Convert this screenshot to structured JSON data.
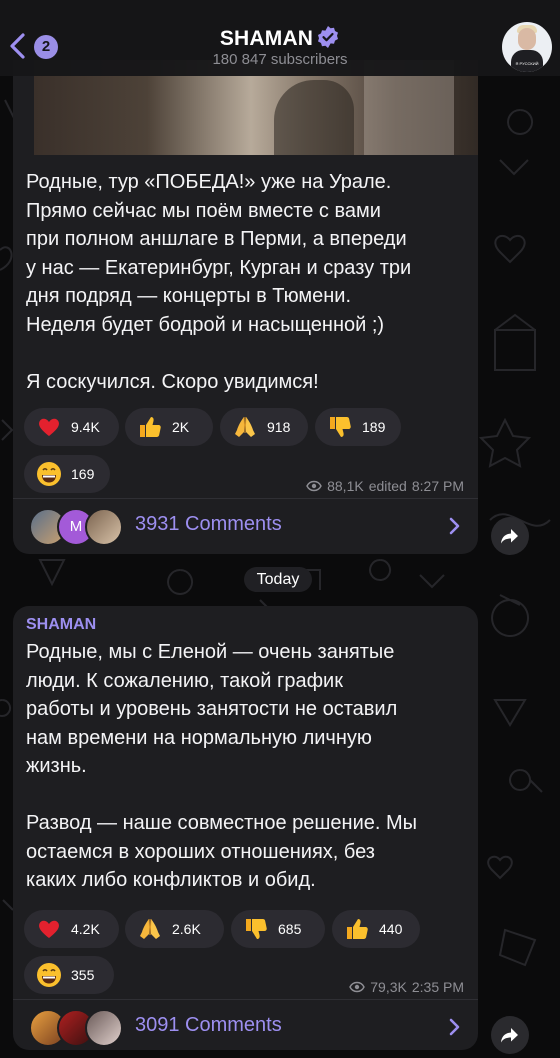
{
  "header": {
    "back_badge": "2",
    "title": "SHAMAN",
    "subtitle": "180 847 subscribers",
    "avatar_caption": "Я РУССКИЙ"
  },
  "posts": [
    {
      "sender": "",
      "text": "Родные, тур «ПОБЕДА!» уже на Урале.\nПрямо сейчас мы поём вместе с вами\nпри полном аншлаге в Перми, а впереди\nу нас — Екатеринбург, Курган и сразу три\nдня подряд — концерты в Тюмени.\nНеделя будет бодрой и насыщенной ;)\n\nЯ соскучился. Скоро увидимся!",
      "reactions": [
        {
          "icon": "heart-icon",
          "count": "9.4K"
        },
        {
          "icon": "thumbs-up-icon",
          "count": "2K"
        },
        {
          "icon": "folded-hands-icon",
          "count": "918"
        },
        {
          "icon": "thumbs-down-icon",
          "count": "189"
        },
        {
          "icon": "grinning-face-icon",
          "count": "169"
        }
      ],
      "views": "88,1K",
      "edited": "edited",
      "time": "8:27 PM",
      "comments": "3931 Comments",
      "commenter_initial": "M"
    },
    {
      "sender": "SHAMAN",
      "text": "Родные, мы с Еленой — очень занятые\nлюди. К сожалению, такой график\nработы и уровень занятости не оставил\nнам времени на нормальную личную\nжизнь.\n\nРазвод — наше совместное решение. Мы\nостаемся в хороших отношениях, без\nкаких либо конфликтов и обид.",
      "reactions": [
        {
          "icon": "heart-icon",
          "count": "4.2K"
        },
        {
          "icon": "folded-hands-icon",
          "count": "2.6K"
        },
        {
          "icon": "thumbs-down-icon",
          "count": "685"
        },
        {
          "icon": "thumbs-up-icon",
          "count": "440"
        },
        {
          "icon": "grinning-face-icon",
          "count": "355"
        }
      ],
      "views": "79,3K",
      "time": "2:35 PM",
      "comments": "3091 Comments"
    }
  ],
  "date_separator": "Today",
  "colors": {
    "accent": "#9d8ff0",
    "bubble": "#1e1e21",
    "background": "#0b0b0c",
    "reaction_pill": "#2c2b31"
  }
}
